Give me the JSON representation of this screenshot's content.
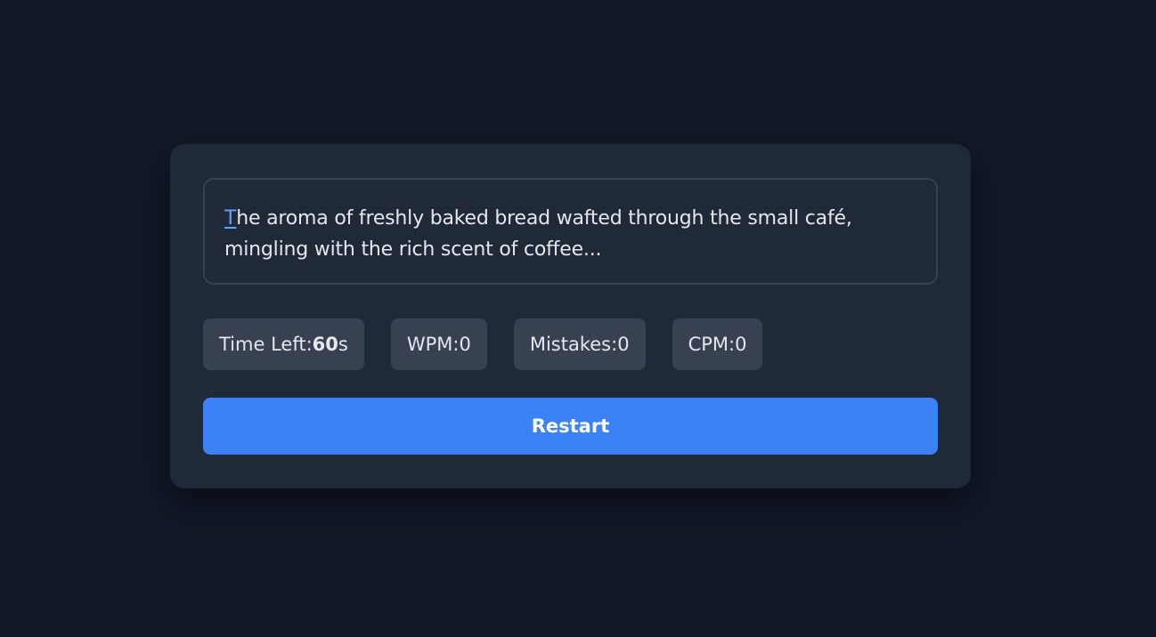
{
  "typing_text": {
    "first_char": "T",
    "rest": "he aroma of freshly baked bread wafted through the small café, mingling with the rich scent of coffee..."
  },
  "stats": {
    "time_label": "Time Left: ",
    "time_value": "60",
    "time_unit": "s",
    "wpm_label": "WPM: ",
    "wpm_value": "0",
    "mistakes_label": "Mistakes: ",
    "mistakes_value": "0",
    "cpm_label": "CPM: ",
    "cpm_value": "0"
  },
  "restart_label": "Restart",
  "colors": {
    "background": "#111827",
    "card": "#1f2937",
    "stat_bg": "#374151",
    "accent": "#3b82f6",
    "cursor": "#60a5fa"
  }
}
